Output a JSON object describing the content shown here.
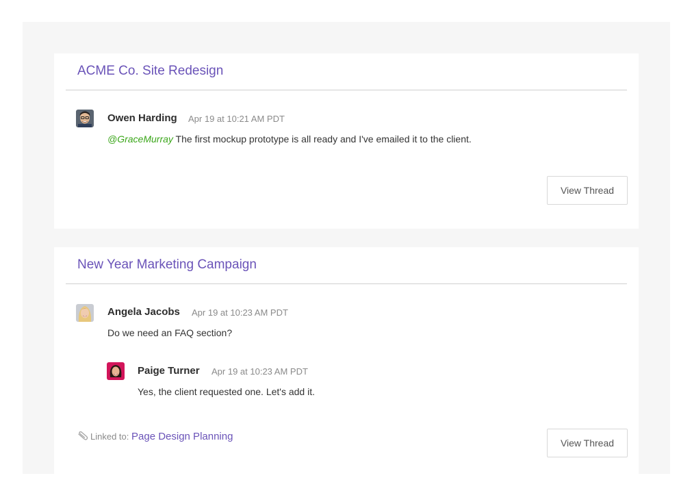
{
  "threads": [
    {
      "title": "ACME Co. Site Redesign",
      "comments": [
        {
          "author": "Owen Harding",
          "time": "Apr 19 at 10:21 AM PDT",
          "mention": "@GraceMurray",
          "text": "The first mockup prototype is all ready and I've emailed it to the client."
        }
      ],
      "button_label": "View Thread"
    },
    {
      "title": "New Year Marketing Campaign",
      "comments": [
        {
          "author": "Angela Jacobs",
          "time": "Apr 19 at 10:23 AM PDT",
          "text": "Do we need an FAQ section?"
        },
        {
          "author": "Paige Turner",
          "time": "Apr 19 at 10:23 AM PDT",
          "text": "Yes, the client requested one. Let's add it."
        }
      ],
      "linked_prefix": "Linked to:",
      "linked_label": "Page Design Planning",
      "button_label": "View Thread"
    }
  ],
  "colors": {
    "accent": "#6a53b8",
    "mention": "#3aa619",
    "panel": "#f6f6f6"
  }
}
